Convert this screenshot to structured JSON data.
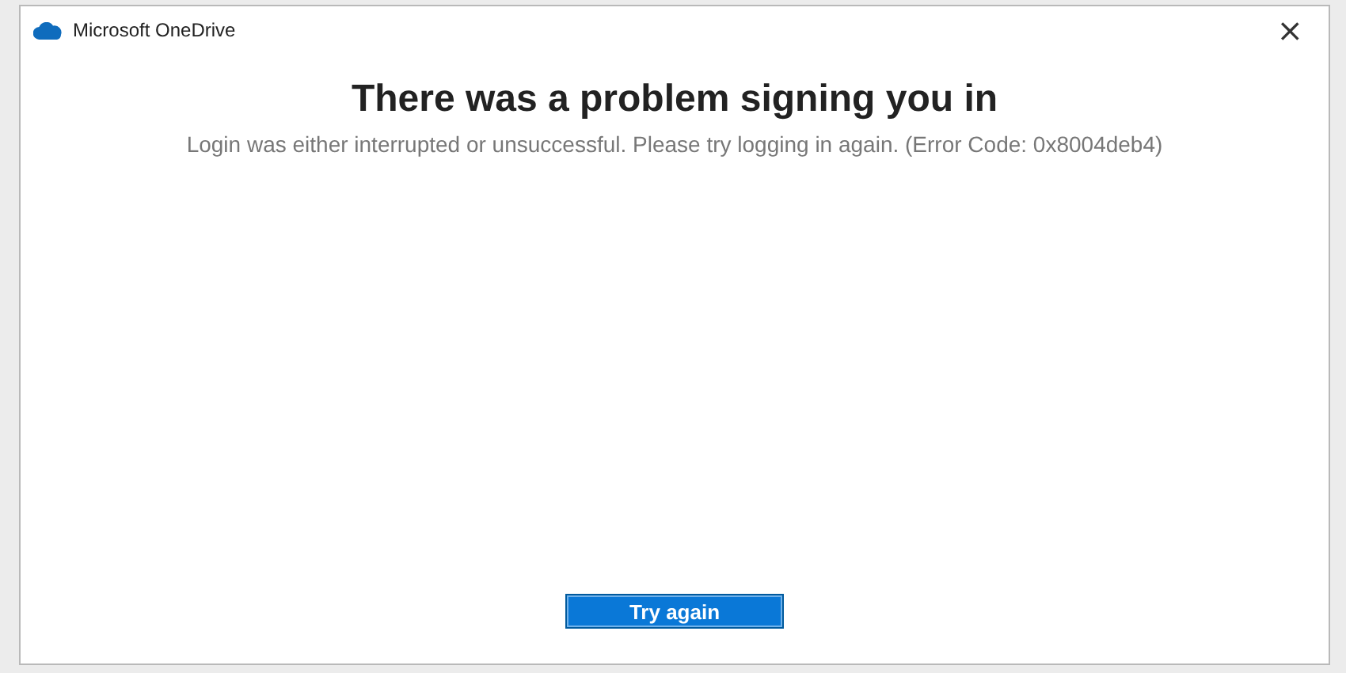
{
  "window": {
    "title": "Microsoft OneDrive",
    "close": "×"
  },
  "heading": "There was a problem signing you in",
  "message": "Login was either interrupted or unsuccessful. Please try logging in again. (Error Code: 0x8004deb4)",
  "buttons": [
    {
      "label": "Try again",
      "primary": true
    }
  ]
}
